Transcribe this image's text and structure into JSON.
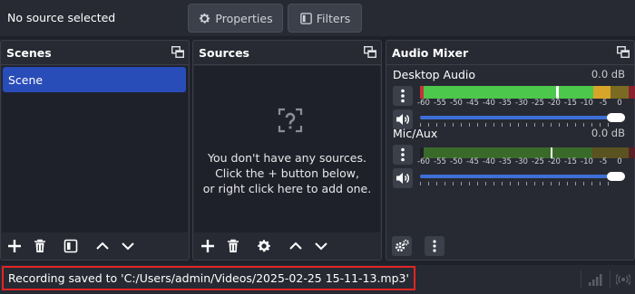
{
  "context_bar": {
    "source_status": "No source selected",
    "properties_label": "Properties",
    "filters_label": "Filters"
  },
  "scenes": {
    "title": "Scenes",
    "items": [
      "Scene"
    ],
    "selected": "Scene"
  },
  "sources": {
    "title": "Sources",
    "empty_line1": "You don't have any sources.",
    "empty_line2": "Click the + button below,",
    "empty_line3": "or right click here to add one."
  },
  "mixer": {
    "title": "Audio Mixer",
    "channels": [
      {
        "name": "Desktop Audio",
        "db": "0.0 dB",
        "volume_fraction": 1.0
      },
      {
        "name": "Mic/Aux",
        "db": "0.0 dB",
        "volume_fraction": 1.0
      }
    ],
    "scale_labels": [
      "-60",
      "-55",
      "-50",
      "-45",
      "-40",
      "-35",
      "-30",
      "-25",
      "-20",
      "-15",
      "-10",
      "-5",
      "0"
    ]
  },
  "status_bar": {
    "message": "Recording saved to 'C:/Users/admin/Videos/2025-02-25 15-11-13.mp3'"
  },
  "colors": {
    "background": "#1f212a",
    "panel": "#272a33",
    "selection": "#284cb8",
    "meter_green": "#4cc84c",
    "meter_yellow": "#d7a628",
    "meter_red": "#c8303a",
    "slider": "#3e6fd8",
    "status_highlight": "#e02525"
  },
  "icons": [
    "gear-icon",
    "filter-icon",
    "undock-icon",
    "plus-icon",
    "trash-icon",
    "filter-icon",
    "arrow-up-icon",
    "arrow-down-icon",
    "question-icon",
    "kebab-icon",
    "speaker-icon",
    "signal-icon",
    "broadcast-icon"
  ]
}
